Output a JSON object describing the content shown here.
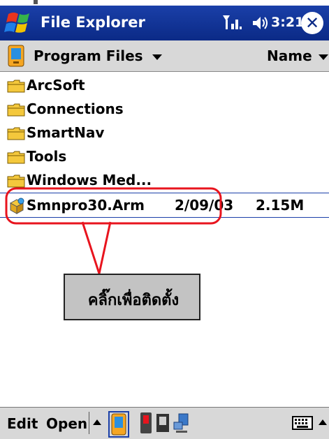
{
  "titlebar": {
    "app_title": "File Explorer",
    "time": "3:21",
    "start_icon": "windows-flag-icon",
    "signal_icon": "signal-antenna-icon",
    "volume_icon": "speaker-volume-icon",
    "close_icon": "close-icon",
    "close_glyph": "✕"
  },
  "pathbar": {
    "folder": "Program Files",
    "sort_label": "Name"
  },
  "files": [
    {
      "name": "ArcSoft",
      "type": "folder"
    },
    {
      "name": "Connections",
      "type": "folder"
    },
    {
      "name": "SmartNav",
      "type": "folder"
    },
    {
      "name": "Tools",
      "type": "folder"
    },
    {
      "name": "Windows Med...",
      "type": "folder"
    },
    {
      "name": "Smnpro30.Arm",
      "type": "file",
      "date": "2/09/03",
      "size": "2.15M",
      "selected": true
    }
  ],
  "annotation": {
    "callout_text": "คลิ๊กเพื่อติดตั้ง",
    "highlight_color": "#e8141e"
  },
  "menubar": {
    "edit_label": "Edit",
    "open_label": "Open"
  },
  "colors": {
    "titlebar": "#0b2a86",
    "selection_line": "#1a3fa8",
    "folder_yellow": "#f4c83c"
  }
}
